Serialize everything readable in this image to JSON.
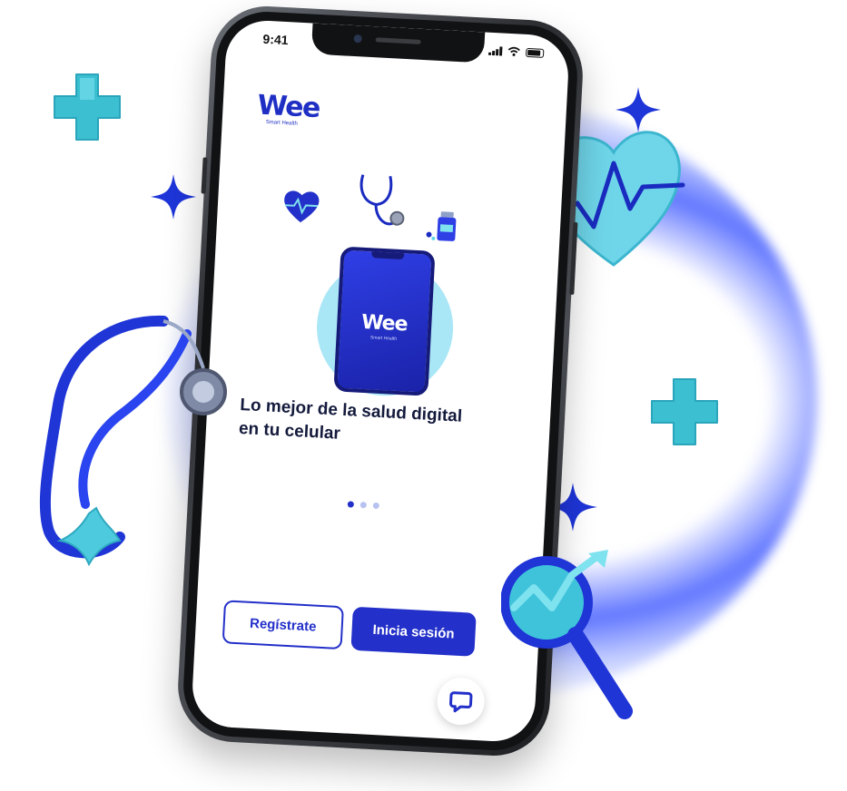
{
  "status_bar": {
    "time": "9:41"
  },
  "brand": {
    "name": "Wee",
    "tagline": "Smart Health"
  },
  "onboarding": {
    "headline_line1": "Lo mejor de la salud digital",
    "headline_line2": "en tu celular",
    "page_index": 1,
    "page_count": 3
  },
  "actions": {
    "register_label": "Regístrate",
    "login_label": "Inicia sesión"
  },
  "icons": [
    "heart-icon",
    "stethoscope-icon",
    "medicine-bottle-icon",
    "chat-icon",
    "signal-icon",
    "wifi-icon",
    "battery-icon"
  ],
  "colors": {
    "brand_blue": "#2330c9",
    "accent_cyan": "#5fd3e8",
    "glow_blue": "#4660ff"
  }
}
